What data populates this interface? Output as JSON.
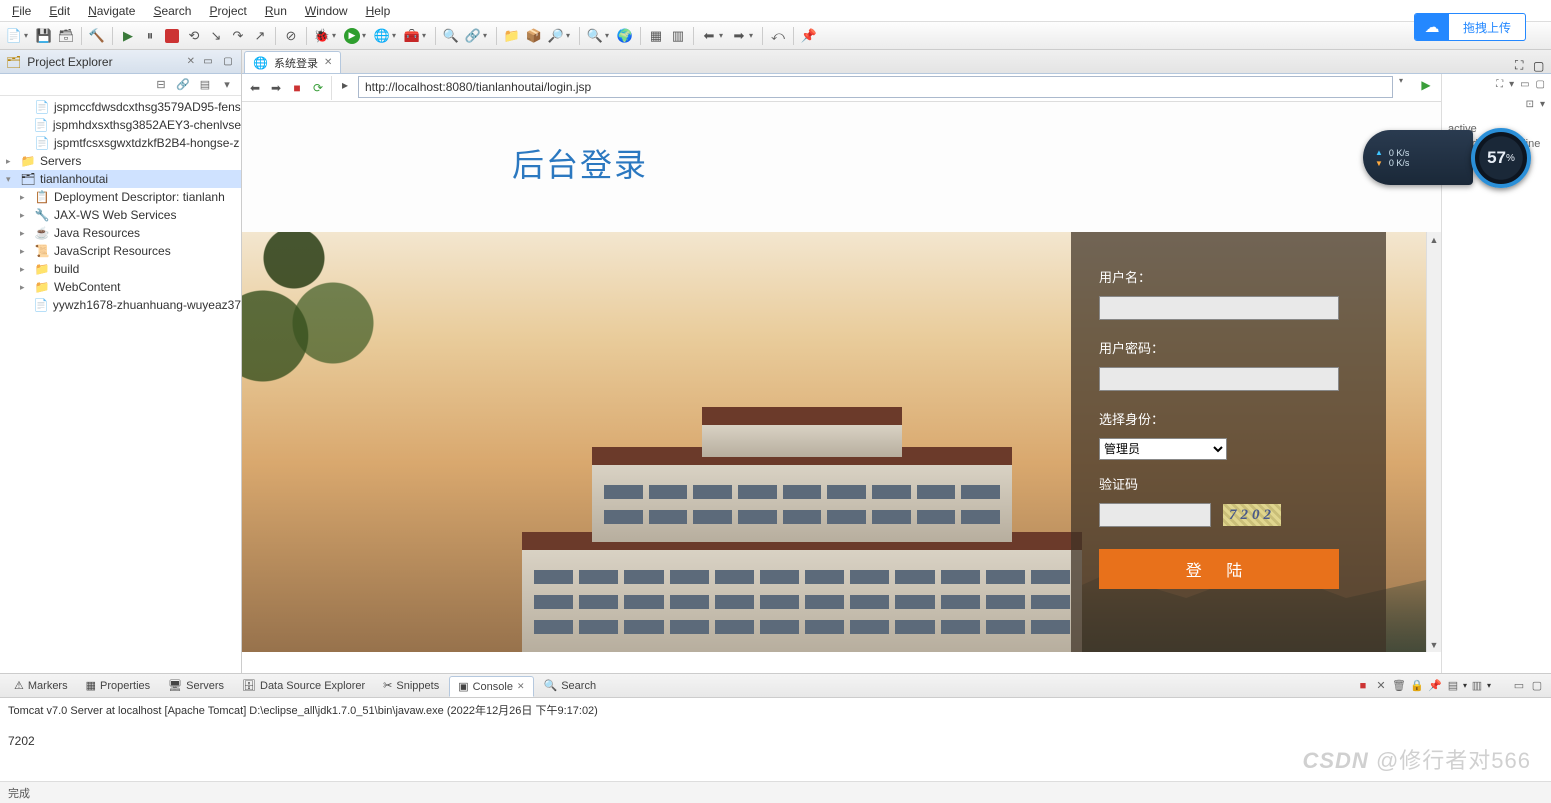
{
  "menubar": [
    "File",
    "Edit",
    "Navigate",
    "Search",
    "Project",
    "Run",
    "Window",
    "Help"
  ],
  "upload_button": "拖拽上传",
  "sidebar": {
    "title": "Project Explorer",
    "items": [
      {
        "icon": "📄",
        "label": "jspmccfdwsdcxthsg3579AD95-fens",
        "indent": 1,
        "arrow": ""
      },
      {
        "icon": "📄",
        "label": "jspmhdxsxthsg3852AEY3-chenlvse",
        "indent": 1,
        "arrow": ""
      },
      {
        "icon": "📄",
        "label": "jspmtfcsxsgwxtdzkfB2B4-hongse-z",
        "indent": 1,
        "arrow": ""
      },
      {
        "icon": "📁",
        "label": "Servers",
        "indent": 0,
        "arrow": "▸"
      },
      {
        "icon": "🗂",
        "label": "tianlanhoutai",
        "indent": 0,
        "arrow": "▾",
        "selected": true
      },
      {
        "icon": "📋",
        "label": "Deployment Descriptor: tianlanh",
        "indent": 1,
        "arrow": "▸"
      },
      {
        "icon": "🔧",
        "label": "JAX-WS Web Services",
        "indent": 1,
        "arrow": "▸"
      },
      {
        "icon": "☕",
        "label": "Java Resources",
        "indent": 1,
        "arrow": "▸"
      },
      {
        "icon": "📜",
        "label": "JavaScript Resources",
        "indent": 1,
        "arrow": "▸"
      },
      {
        "icon": "📁",
        "label": "build",
        "indent": 1,
        "arrow": "▸"
      },
      {
        "icon": "📁",
        "label": "WebContent",
        "indent": 1,
        "arrow": "▸"
      },
      {
        "icon": "📄",
        "label": "yywzh1678-zhuanhuang-wuyeaz37",
        "indent": 1,
        "arrow": ""
      }
    ]
  },
  "editor_tab": {
    "title": "系统登录"
  },
  "url": "http://localhost:8080/tianlanhoutai/login.jsp",
  "outline_text_top": "active",
  "outline_text": "provides an outline",
  "login": {
    "title": "后台登录",
    "username_label": "用户名：",
    "password_label": "用户密码：",
    "role_label": "选择身份：",
    "role_value": "管理员",
    "captcha_label": "验证码",
    "captcha_text": "7202",
    "submit": "登 陆"
  },
  "net": {
    "up": "0 K/s",
    "down": "0 K/s"
  },
  "pct": "57",
  "bottom": {
    "tabs": [
      "Markers",
      "Properties",
      "Servers",
      "Data Source Explorer",
      "Snippets",
      "Console",
      "Search"
    ],
    "active": 5,
    "server_line": "Tomcat v7.0 Server at localhost [Apache Tomcat] D:\\eclipse_all\\jdk1.7.0_51\\bin\\javaw.exe (2022年12月26日 下午9:17:02)",
    "output": "7202"
  },
  "statusbar": "完成",
  "watermark": "CSDN @修行者对566"
}
